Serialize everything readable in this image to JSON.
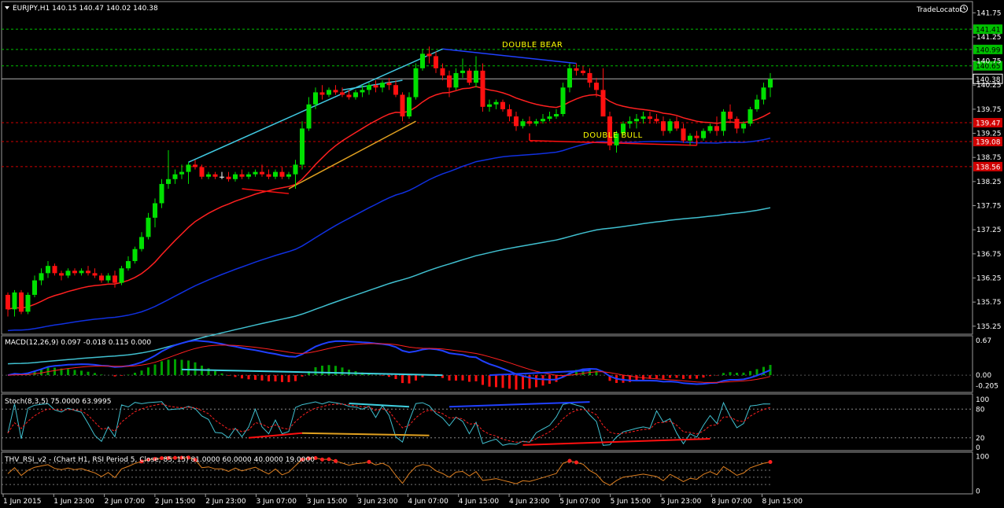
{
  "header": {
    "symbol_info": "EURJPY,H1  140.15 140.47 140.02 140.38",
    "trade_locator": "TradeLocator"
  },
  "colors": {
    "background": "#000000",
    "bull_candle": "#00e000",
    "bear_candle": "#ff1010",
    "doji": "#ffffff",
    "ema_fast": "#ff2020",
    "ema_mid": "#1030e0",
    "ema_slow": "#40c0d0",
    "annotation_text": "#ffff00",
    "level_green": "#00c000",
    "level_red": "#d00000"
  },
  "chart_data": [
    {
      "type": "candlestick",
      "panel": "price",
      "y_ticks": [
        "141.75",
        "141.25",
        "140.75",
        "140.25",
        "139.75",
        "139.25",
        "138.75",
        "138.25",
        "137.75",
        "137.25",
        "136.75",
        "136.25",
        "135.75",
        "135.25"
      ],
      "ylim": [
        135.1,
        141.95
      ],
      "levels": [
        {
          "price": 141.41,
          "label": "141.41",
          "color": "green"
        },
        {
          "price": 140.99,
          "label": "140.99",
          "color": "green"
        },
        {
          "price": 140.65,
          "label": "140.65",
          "color": "green"
        },
        {
          "price": 140.38,
          "label": "140.38",
          "color": "white"
        },
        {
          "price": 139.47,
          "label": "139.47",
          "color": "red"
        },
        {
          "price": 139.08,
          "label": "139.08",
          "color": "red"
        },
        {
          "price": 138.56,
          "label": "138.56",
          "color": "red"
        }
      ],
      "annotations": [
        {
          "text": "DOUBLE BEAR",
          "x": 65,
          "y": 140.75
        },
        {
          "text": "DOUBLE BULL",
          "x": 75,
          "y": 138.97
        }
      ],
      "candles_ohlc": [
        [
          135.9,
          135.95,
          135.45,
          135.6
        ],
        [
          135.6,
          136.0,
          135.45,
          135.95
        ],
        [
          135.95,
          136.0,
          135.5,
          135.55
        ],
        [
          135.55,
          135.95,
          135.5,
          135.9
        ],
        [
          135.9,
          136.3,
          135.85,
          136.2
        ],
        [
          136.2,
          136.45,
          136.1,
          136.35
        ],
        [
          136.35,
          136.6,
          136.25,
          136.5
        ],
        [
          136.5,
          136.55,
          136.3,
          136.35
        ],
        [
          136.35,
          136.4,
          136.2,
          136.3
        ],
        [
          136.3,
          136.45,
          136.25,
          136.4
        ],
        [
          136.4,
          136.45,
          136.3,
          136.35
        ],
        [
          136.35,
          136.45,
          136.3,
          136.4
        ],
        [
          136.4,
          136.5,
          136.3,
          136.35
        ],
        [
          136.35,
          136.45,
          136.25,
          136.3
        ],
        [
          136.3,
          136.35,
          136.15,
          136.2
        ],
        [
          136.2,
          136.35,
          136.15,
          136.3
        ],
        [
          136.3,
          136.4,
          136.05,
          136.15
        ],
        [
          136.15,
          136.5,
          136.1,
          136.45
        ],
        [
          136.45,
          136.7,
          136.4,
          136.6
        ],
        [
          136.6,
          136.9,
          136.55,
          136.85
        ],
        [
          136.85,
          137.2,
          136.8,
          137.1
        ],
        [
          137.1,
          137.6,
          137.05,
          137.5
        ],
        [
          137.5,
          137.9,
          137.3,
          137.8
        ],
        [
          137.8,
          138.3,
          137.7,
          138.2
        ],
        [
          138.2,
          138.9,
          138.1,
          138.3
        ],
        [
          138.3,
          138.5,
          138.2,
          138.4
        ],
        [
          138.4,
          138.6,
          138.3,
          138.45
        ],
        [
          138.45,
          138.65,
          138.2,
          138.6
        ],
        [
          138.6,
          138.7,
          138.5,
          138.55
        ],
        [
          138.55,
          138.6,
          138.3,
          138.35
        ],
        [
          138.35,
          138.45,
          138.3,
          138.4
        ],
        [
          138.4,
          138.45,
          138.3,
          138.35
        ],
        [
          138.35,
          138.45,
          138.3,
          138.35
        ],
        [
          138.35,
          138.45,
          138.25,
          138.3
        ],
        [
          138.3,
          138.45,
          138.25,
          138.4
        ],
        [
          138.4,
          138.5,
          138.3,
          138.35
        ],
        [
          138.35,
          138.45,
          138.3,
          138.4
        ],
        [
          138.4,
          138.5,
          138.35,
          138.45
        ],
        [
          138.45,
          138.6,
          138.35,
          138.4
        ],
        [
          138.4,
          138.5,
          138.3,
          138.35
        ],
        [
          138.35,
          138.5,
          138.3,
          138.45
        ],
        [
          138.45,
          138.55,
          138.3,
          138.35
        ],
        [
          138.35,
          138.45,
          138.3,
          138.4
        ],
        [
          138.4,
          138.7,
          138.1,
          138.6
        ],
        [
          138.6,
          139.5,
          138.5,
          139.35
        ],
        [
          139.35,
          140.0,
          139.3,
          139.85
        ],
        [
          139.85,
          140.2,
          139.75,
          140.1
        ],
        [
          140.1,
          140.25,
          139.95,
          140.05
        ],
        [
          140.05,
          140.2,
          140.0,
          140.15
        ],
        [
          140.15,
          140.25,
          140.05,
          140.1
        ],
        [
          140.1,
          140.2,
          140.0,
          140.05
        ],
        [
          140.05,
          140.15,
          139.95,
          140.0
        ],
        [
          140.0,
          140.15,
          139.95,
          140.1
        ],
        [
          140.1,
          140.25,
          140.0,
          140.15
        ],
        [
          140.15,
          140.3,
          140.05,
          140.25
        ],
        [
          140.25,
          140.35,
          140.1,
          140.2
        ],
        [
          140.2,
          140.35,
          140.1,
          140.3
        ],
        [
          140.3,
          140.4,
          140.15,
          140.25
        ],
        [
          140.25,
          140.35,
          140.0,
          140.05
        ],
        [
          140.05,
          140.1,
          139.5,
          139.6
        ],
        [
          139.6,
          140.1,
          139.55,
          140.0
        ],
        [
          140.0,
          140.7,
          139.95,
          140.6
        ],
        [
          140.6,
          141.0,
          140.55,
          140.9
        ],
        [
          140.9,
          141.05,
          140.7,
          140.85
        ],
        [
          140.85,
          140.95,
          140.5,
          140.6
        ],
        [
          140.6,
          140.7,
          140.35,
          140.45
        ],
        [
          140.45,
          140.55,
          140.0,
          140.2
        ],
        [
          140.2,
          140.6,
          140.15,
          140.5
        ],
        [
          140.5,
          140.8,
          140.4,
          140.55
        ],
        [
          140.55,
          140.6,
          140.25,
          140.3
        ],
        [
          140.3,
          140.85,
          140.2,
          140.55
        ],
        [
          140.55,
          140.7,
          139.7,
          139.8
        ],
        [
          139.8,
          139.95,
          139.7,
          139.85
        ],
        [
          139.85,
          139.95,
          139.75,
          139.9
        ],
        [
          139.9,
          139.95,
          139.7,
          139.75
        ],
        [
          139.75,
          139.85,
          139.5,
          139.6
        ],
        [
          139.6,
          139.7,
          139.3,
          139.4
        ],
        [
          139.4,
          139.55,
          139.35,
          139.5
        ],
        [
          139.5,
          139.6,
          139.4,
          139.45
        ],
        [
          139.45,
          139.55,
          139.4,
          139.5
        ],
        [
          139.5,
          139.65,
          139.45,
          139.55
        ],
        [
          139.55,
          139.7,
          139.5,
          139.6
        ],
        [
          139.6,
          139.75,
          139.55,
          139.65
        ],
        [
          139.65,
          140.3,
          139.6,
          140.2
        ],
        [
          140.2,
          140.7,
          140.1,
          140.6
        ],
        [
          140.6,
          140.7,
          140.45,
          140.55
        ],
        [
          140.55,
          140.65,
          140.45,
          140.5
        ],
        [
          140.5,
          140.6,
          140.2,
          140.3
        ],
        [
          140.3,
          140.4,
          140.0,
          140.15
        ],
        [
          140.15,
          140.6,
          140.1,
          139.6
        ],
        [
          139.6,
          139.7,
          138.9,
          139.0
        ],
        [
          139.0,
          139.3,
          138.85,
          139.25
        ],
        [
          139.25,
          139.5,
          139.2,
          139.45
        ],
        [
          139.45,
          139.6,
          139.35,
          139.5
        ],
        [
          139.5,
          139.65,
          139.35,
          139.55
        ],
        [
          139.55,
          139.7,
          139.45,
          139.6
        ],
        [
          139.6,
          139.7,
          139.45,
          139.55
        ],
        [
          139.55,
          139.65,
          139.45,
          139.5
        ],
        [
          139.5,
          139.6,
          139.2,
          139.3
        ],
        [
          139.3,
          139.55,
          139.25,
          139.5
        ],
        [
          139.5,
          139.6,
          139.3,
          139.35
        ],
        [
          139.35,
          139.45,
          139.05,
          139.1
        ],
        [
          139.1,
          139.25,
          139.0,
          139.2
        ],
        [
          139.2,
          139.3,
          139.05,
          139.15
        ],
        [
          139.15,
          139.35,
          139.1,
          139.3
        ],
        [
          139.3,
          139.45,
          139.25,
          139.4
        ],
        [
          139.4,
          139.6,
          139.2,
          139.3
        ],
        [
          139.3,
          139.75,
          139.2,
          139.7
        ],
        [
          139.7,
          139.85,
          139.5,
          139.55
        ],
        [
          139.55,
          139.6,
          139.25,
          139.35
        ],
        [
          139.35,
          139.5,
          139.25,
          139.45
        ],
        [
          139.45,
          139.8,
          139.4,
          139.75
        ],
        [
          139.75,
          140.05,
          139.7,
          139.95
        ],
        [
          139.95,
          140.3,
          139.85,
          140.2
        ],
        [
          140.2,
          140.5,
          140.0,
          140.38
        ]
      ]
    },
    {
      "type": "line",
      "panel": "macd",
      "label": "MACD(12,26,9) 0.097 -0.018 0.115 0.000",
      "y_ticks": [
        "0.67",
        "0.00",
        "-0.205"
      ],
      "ylim": [
        -0.32,
        0.75
      ]
    },
    {
      "type": "line",
      "panel": "stoch",
      "label": "Stoch(8,3,5) 75.0000 63.9995",
      "y_ticks": [
        "100",
        "80",
        "20",
        "0"
      ],
      "ylim": [
        -5,
        110
      ]
    },
    {
      "type": "line",
      "panel": "rsi",
      "label": "THV_RSI_v2 - (Chart H1,  RSI Period 5,  Close,  85,  15)  81.0000 60.0000 40.0000 19.0000",
      "y_ticks": [
        "100",
        "0"
      ],
      "ylim": [
        -8,
        110
      ]
    }
  ],
  "x_axis": [
    "1 Jun 2015",
    "1 Jun 23:00",
    "2 Jun 07:00",
    "2 Jun 15:00",
    "2 Jun 23:00",
    "3 Jun 07:00",
    "3 Jun 15:00",
    "3 Jun 23:00",
    "4 Jun 07:00",
    "4 Jun 15:00",
    "4 Jun 23:00",
    "5 Jun 07:00",
    "5 Jun 15:00",
    "5 Jun 23:00",
    "8 Jun 07:00",
    "8 Jun 15:00"
  ]
}
